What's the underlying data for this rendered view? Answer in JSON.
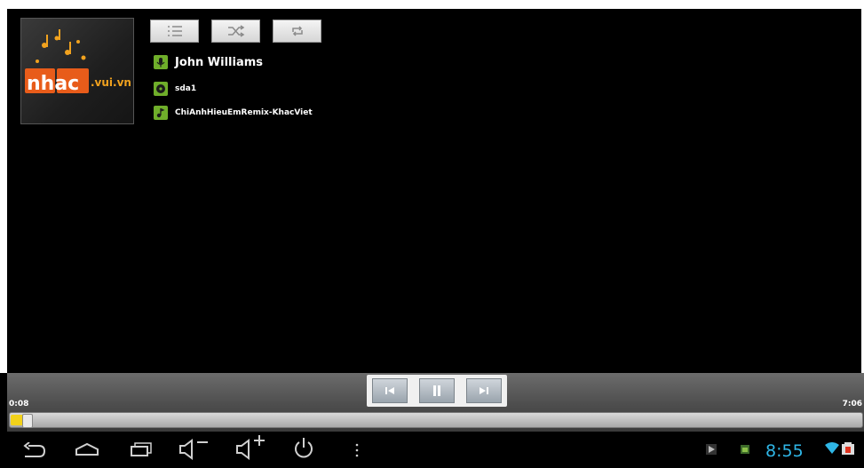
{
  "album_art": {
    "logo_text_main": "nhac",
    "logo_text_domain": ".vui.vn"
  },
  "top_buttons": [
    {
      "name": "playlist",
      "icon": "list-icon"
    },
    {
      "name": "shuffle",
      "icon": "shuffle-icon"
    },
    {
      "name": "repeat",
      "icon": "repeat-icon"
    }
  ],
  "track": {
    "artist": "John Williams",
    "album": "sda1",
    "title": "ChiAnhHieuEmRemix-KhacViet"
  },
  "playback": {
    "elapsed": "0:08",
    "duration": "7:06",
    "progress_fraction": 0.019
  },
  "controls": {
    "prev_icon": "previous-icon",
    "play_pause_icon": "pause-icon",
    "next_icon": "next-icon"
  },
  "status_bar": {
    "clock": "8:55"
  },
  "colors": {
    "accent_green": "#6fae2a",
    "seek_yellow": "#f2d21a",
    "clock_blue": "#2fb6e6"
  }
}
